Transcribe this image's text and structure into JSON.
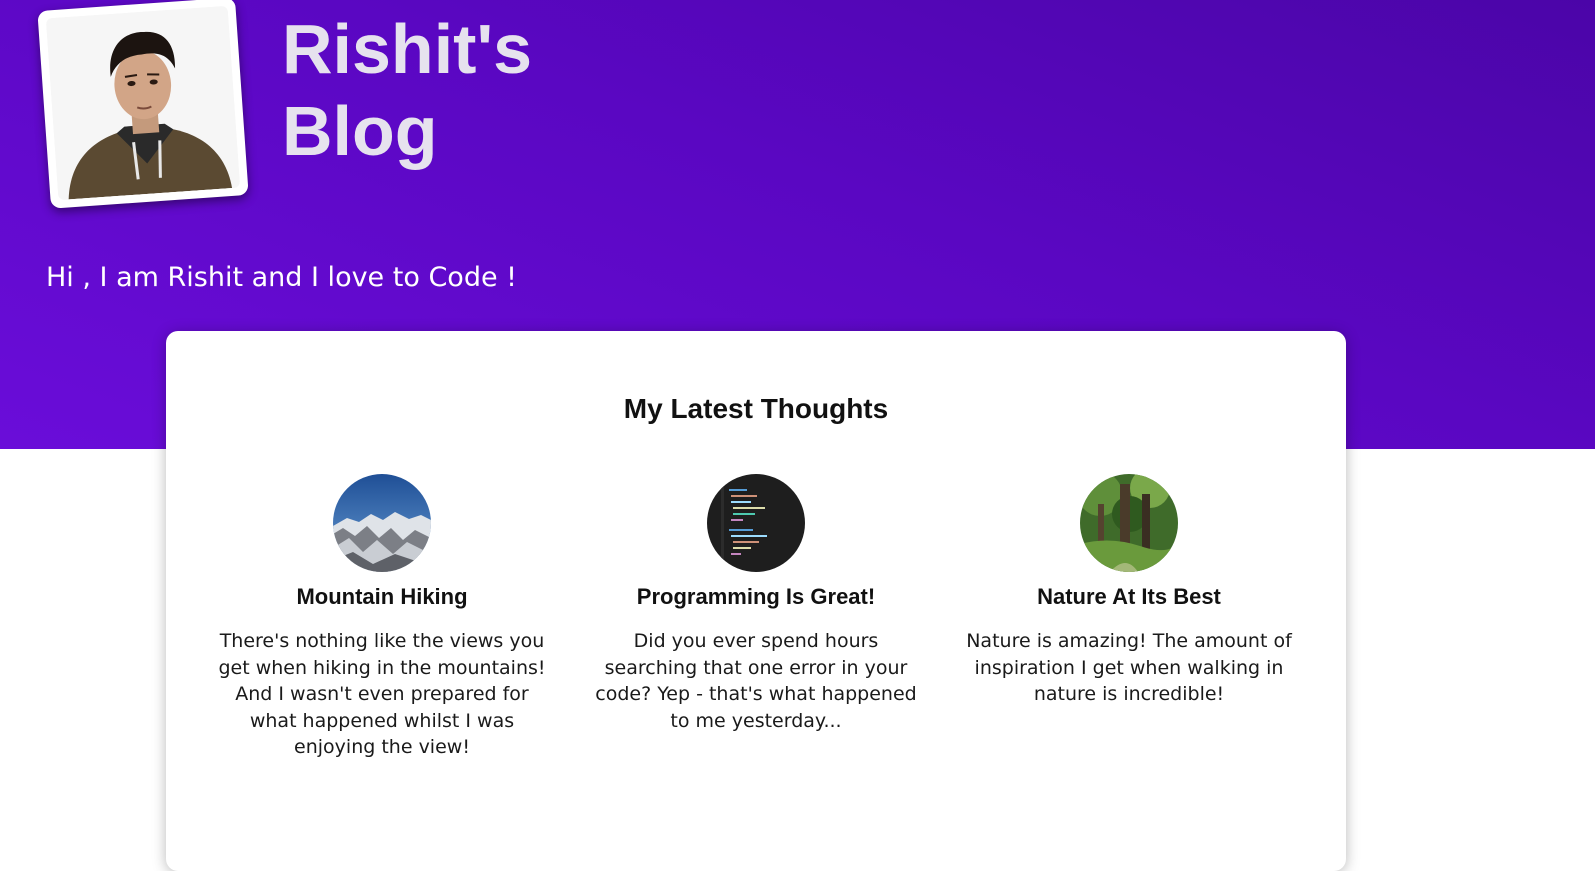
{
  "header": {
    "title": "Rishit's Blog",
    "tagline": "Hi , I am Rishit and I love to Code !",
    "avatar_icon": "profile-photo",
    "gradient_colors": [
      "#4b05a8",
      "#6a0dd9"
    ]
  },
  "section": {
    "heading": "My Latest Thoughts"
  },
  "posts": [
    {
      "title": "Mountain Hiking",
      "text": "There's nothing like the views you get when hiking in the mountains! And I wasn't even prepared for what happened whilst I was enjoying the view!",
      "thumbnail": "mountain-image"
    },
    {
      "title": "Programming Is Great!",
      "text": "Did you ever spend hours searching that one error in your code? Yep - that's what happened to me yesterday...",
      "thumbnail": "code-editor-image"
    },
    {
      "title": "Nature At Its Best",
      "text": "Nature is amazing! The amount of inspiration I get when walking in nature is incredible!",
      "thumbnail": "forest-image"
    }
  ]
}
